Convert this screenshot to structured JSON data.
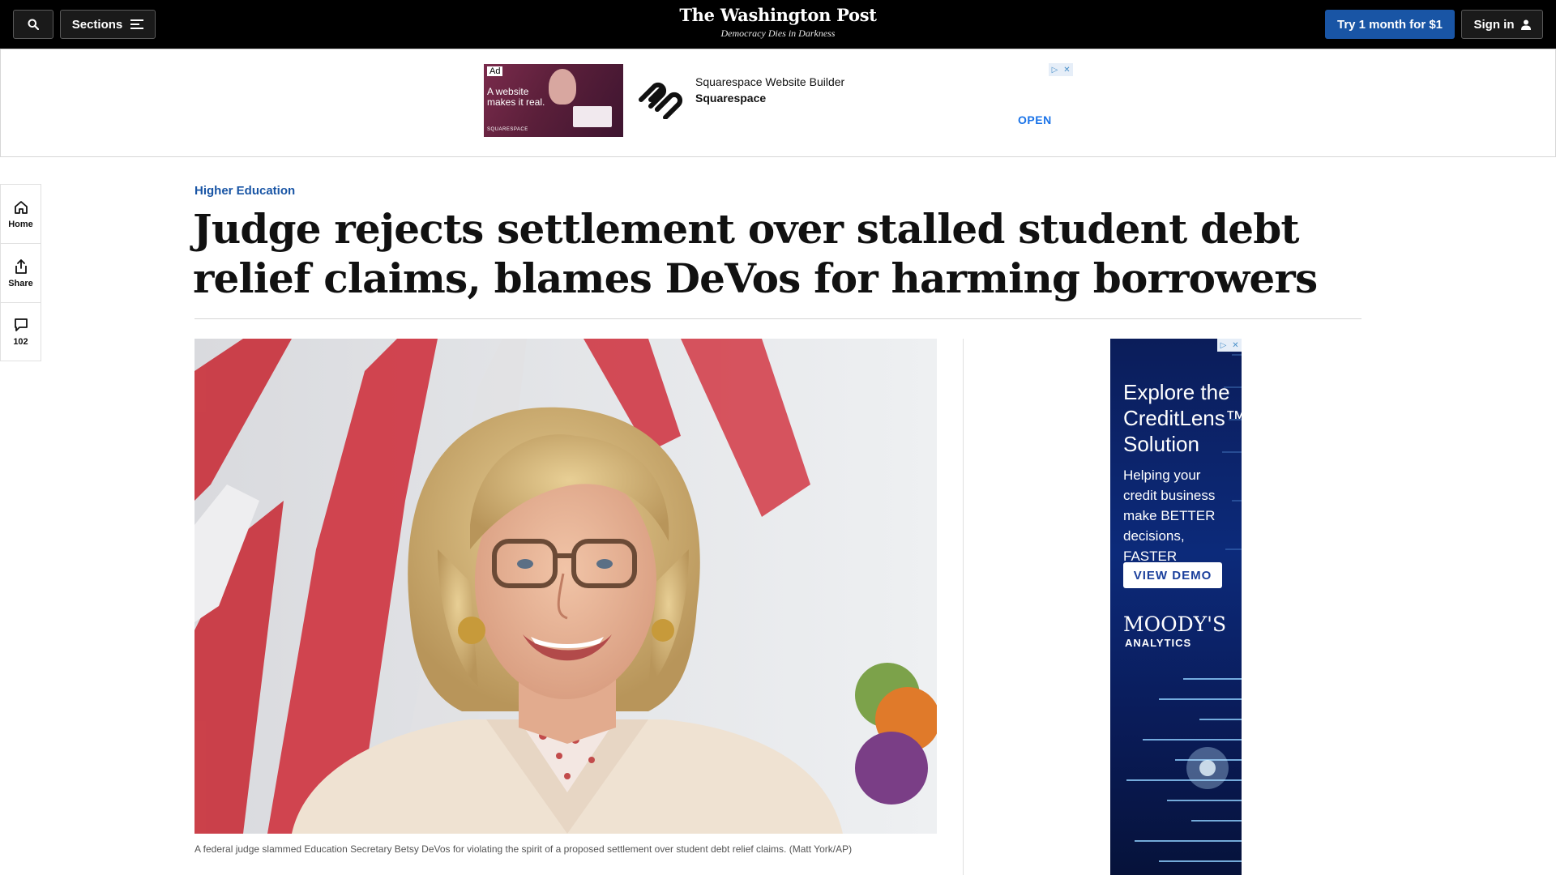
{
  "header": {
    "search_icon": "search-icon",
    "sections_label": "Sections",
    "logo_text": "The Washington Post",
    "tagline": "Democracy Dies in Darkness",
    "subscribe_label": "Try 1 month for $1",
    "signin_label": "Sign in"
  },
  "top_ad": {
    "badge": "Ad",
    "creative_text": "A website makes it real.",
    "creative_brand": "SQUARESPACE",
    "title": "Squarespace Website Builder",
    "advertiser": "Squarespace",
    "cta": "OPEN",
    "choices_icons": [
      "adchoices-icon",
      "close-icon"
    ]
  },
  "rail": {
    "items": [
      {
        "icon": "home-icon",
        "label": "Home"
      },
      {
        "icon": "share-icon",
        "label": "Share"
      },
      {
        "icon": "comment-icon",
        "label": "102"
      }
    ]
  },
  "article": {
    "kicker": "Higher Education",
    "headline": "Judge rejects settlement over stalled student debt relief claims, blames DeVos for harming borrowers",
    "caption": "A federal judge slammed Education Secretary Betsy DeVos for violating the spirit of a proposed settlement over student debt relief claims. (Matt York/AP)"
  },
  "right_ad": {
    "heading": "Explore the CreditLens™ Solution",
    "body": "Helping your credit business make BETTER decisions, FASTER",
    "cta": "VIEW DEMO",
    "brand": "MOODY'S",
    "brand_sub": "ANALYTICS"
  },
  "colors": {
    "header_bg": "#000000",
    "accent_blue": "#1955a5",
    "kicker_blue": "#1955a5",
    "ad_open_blue": "#1a73e8"
  }
}
